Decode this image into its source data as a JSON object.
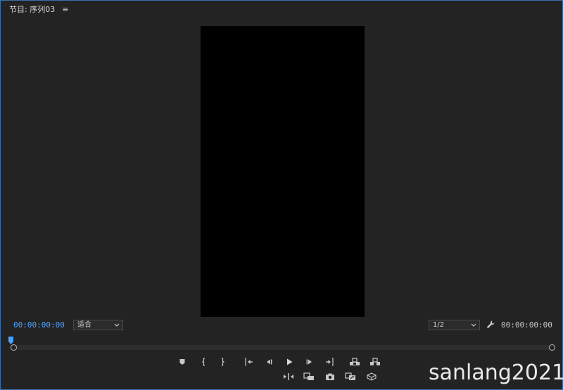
{
  "panel": {
    "title": "节目: 序列03",
    "menu_icon": "hamburger-menu-icon"
  },
  "viewer": {
    "background": "#000000"
  },
  "status": {
    "current_timecode": "00:00:00:00",
    "duration_timecode": "00:00:00:00",
    "zoom_value": "适合",
    "resolution_value": "1/2",
    "accent": "#4ca3ff"
  },
  "transport_row1": [
    {
      "name": "add-marker-button",
      "icon": "marker-icon"
    },
    {
      "name": "mark-in-button",
      "icon": "mark-in-icon"
    },
    {
      "name": "mark-out-button",
      "icon": "mark-out-icon"
    },
    {
      "name": "go-to-in-button",
      "icon": "go-to-in-icon"
    },
    {
      "name": "step-back-button",
      "icon": "step-back-icon"
    },
    {
      "name": "play-button",
      "icon": "play-icon"
    },
    {
      "name": "step-forward-button",
      "icon": "step-forward-icon"
    },
    {
      "name": "go-to-out-button",
      "icon": "go-to-out-icon"
    },
    {
      "name": "lift-button",
      "icon": "lift-icon"
    },
    {
      "name": "extract-button",
      "icon": "extract-icon"
    }
  ],
  "transport_row2": [
    {
      "name": "insert-button",
      "icon": "insert-icon"
    },
    {
      "name": "overwrite-button",
      "icon": "overwrite-icon"
    },
    {
      "name": "export-frame-button",
      "icon": "camera-icon"
    },
    {
      "name": "comparison-view-button",
      "icon": "comparison-icon"
    },
    {
      "name": "vr-video-button",
      "icon": "vr-icon"
    }
  ],
  "watermark": "sanlang2021"
}
